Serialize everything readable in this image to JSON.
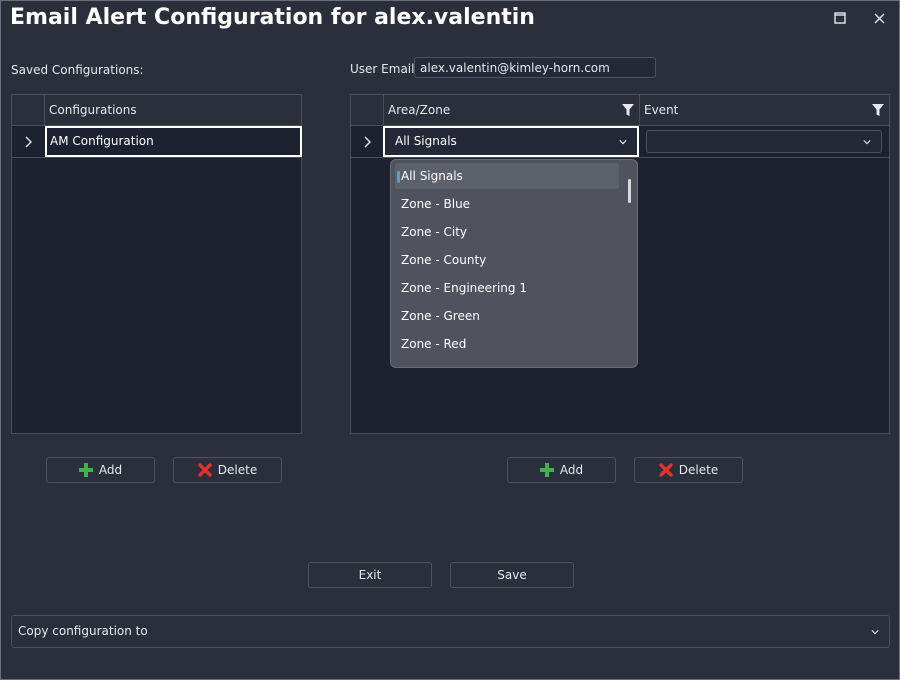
{
  "window": {
    "title": "Email Alert Configuration for alex.valentin",
    "maximize_glyph": "□",
    "close_glyph": "✕"
  },
  "left_panel": {
    "label": "Saved Configurations:",
    "column_header": "Configurations",
    "rows": [
      "AM Configuration"
    ],
    "add_label": "Add",
    "delete_label": "Delete"
  },
  "right_panel": {
    "email_label": "User Email:",
    "email_value": "alex.valentin@kimley-horn.com",
    "columns": [
      "Area/Zone",
      "Event"
    ],
    "selected_area": "All Signals",
    "selected_event": "",
    "dropdown_options": [
      "All Signals",
      "Zone - Blue",
      "Zone - City",
      "Zone - County",
      "Zone - Engineering 1",
      "Zone - Green",
      "Zone - Red"
    ],
    "add_label": "Add",
    "delete_label": "Delete"
  },
  "footer": {
    "exit_label": "Exit",
    "save_label": "Save",
    "copy_label": "Copy configuration to"
  },
  "icons": {
    "add": "plus-icon",
    "delete": "x-icon",
    "filter": "filter-icon",
    "row_expand": "chevron-right-icon",
    "combo": "chevron-down-icon"
  },
  "colors": {
    "background": "#2b2e3b",
    "grid_background": "#1e2130",
    "add_green": "#3cb44b",
    "delete_red": "#e0322f",
    "dropdown_bg": "#50535e"
  }
}
